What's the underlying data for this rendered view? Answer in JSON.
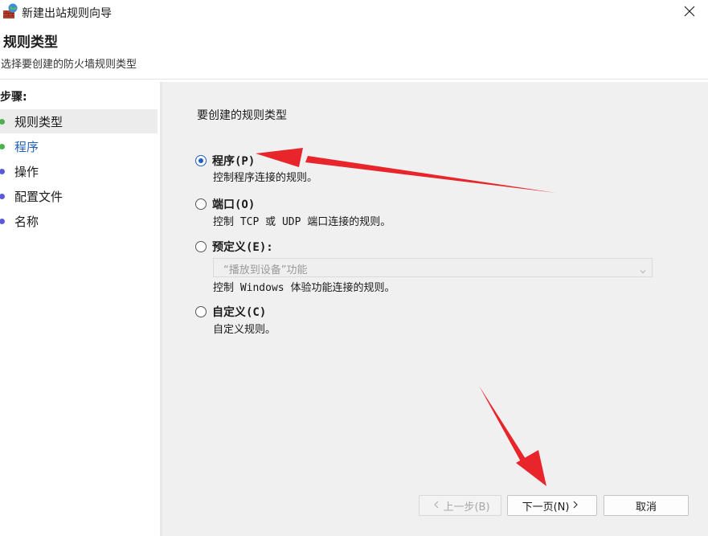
{
  "window": {
    "title": "新建出站规则向导",
    "icon": "firewall-icon",
    "close_icon": "close-icon"
  },
  "header": {
    "title": "规则类型",
    "subtitle": "选择要创建的防火墙规则类型"
  },
  "steps": {
    "label": "步骤:",
    "items": [
      {
        "label": "规则类型",
        "dot_color": "#4caf50",
        "state": "active"
      },
      {
        "label": "程序",
        "dot_color": "#4caf50",
        "state": "current"
      },
      {
        "label": "操作",
        "dot_color": "#5b5bd6",
        "state": "pending"
      },
      {
        "label": "配置文件",
        "dot_color": "#5b5bd6",
        "state": "pending"
      },
      {
        "label": "名称",
        "dot_color": "#5b5bd6",
        "state": "pending"
      }
    ]
  },
  "main": {
    "section_title": "要创建的规则类型",
    "options": [
      {
        "label": "程序(P)",
        "desc": "控制程序连接的规则。",
        "checked": true
      },
      {
        "label": "端口(O)",
        "desc": "控制 TCP 或 UDP 端口连接的规则。",
        "checked": false
      },
      {
        "label": "预定义(E):",
        "desc": "控制 Windows 体验功能连接的规则。",
        "checked": false
      },
      {
        "label": "自定义(C)",
        "desc": "自定义规则。",
        "checked": false
      }
    ],
    "predefined_dropdown": {
      "value": "“播放到设备”功能",
      "enabled": false
    }
  },
  "buttons": {
    "back": "上一步(B)",
    "next": "下一页(N)",
    "cancel": "取消"
  },
  "colors": {
    "accent": "#1f5fbf",
    "annotation_arrow": "#e8252a",
    "content_bg": "#f0f0f0"
  }
}
